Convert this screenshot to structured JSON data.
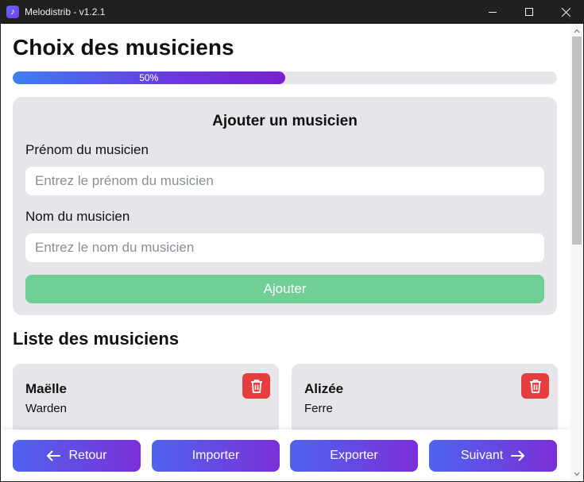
{
  "window": {
    "title": "Melodistrib - v1.2.1"
  },
  "page": {
    "title": "Choix des musiciens"
  },
  "progress": {
    "value": 0.5,
    "label": "50%"
  },
  "add_form": {
    "title": "Ajouter un musicien",
    "first_name_label": "Prénom du musicien",
    "first_name_placeholder": "Entrez le prénom du musicien",
    "first_name_value": "",
    "last_name_label": "Nom du musicien",
    "last_name_placeholder": "Entrez le nom du musicien",
    "last_name_value": "",
    "submit_label": "Ajouter"
  },
  "list": {
    "title": "Liste des musiciens",
    "musicians": [
      {
        "first_name": "Maëlle",
        "last_name": "Warden"
      },
      {
        "first_name": "Alizée",
        "last_name": "Ferre"
      }
    ]
  },
  "footer": {
    "back_label": "Retour",
    "import_label": "Importer",
    "export_label": "Exporter",
    "next_label": "Suivant"
  },
  "colors": {
    "accent_start": "#4f63ee",
    "accent_end": "#7b2fd8",
    "add_button": "#6fcf97",
    "delete_button": "#e53e3e",
    "card_bg": "#e6e6ea"
  },
  "icons": {
    "app": "music-note-icon",
    "delete": "trash-icon",
    "back": "arrow-left-icon",
    "next": "arrow-right-icon"
  }
}
